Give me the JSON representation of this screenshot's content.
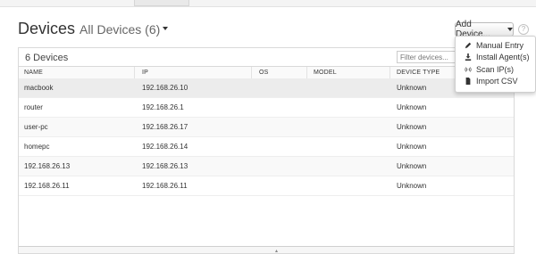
{
  "header": {
    "title": "Devices",
    "subtitle": "All Devices (6)"
  },
  "toolbar": {
    "add_label": "Add Device...",
    "help_glyph": "?"
  },
  "add_menu": {
    "items": [
      {
        "label": "Manual Entry",
        "icon": "pencil-icon"
      },
      {
        "label": "Install Agent(s)",
        "icon": "download-icon"
      },
      {
        "label": "Scan IP(s)",
        "icon": "scan-icon"
      },
      {
        "label": "Import CSV",
        "icon": "file-icon"
      }
    ]
  },
  "list": {
    "count": "6 Devices",
    "filter_placeholder": "Filter devices...",
    "columns": [
      "NAME",
      "IP",
      "OS",
      "MODEL",
      "DEVICE TYPE"
    ],
    "rows": [
      {
        "name": "macbook",
        "ip": "192.168.26.10",
        "os": "",
        "model": "",
        "type": "Unknown"
      },
      {
        "name": "router",
        "ip": "192.168.26.1",
        "os": "",
        "model": "",
        "type": "Unknown"
      },
      {
        "name": "user-pc",
        "ip": "192.168.26.17",
        "os": "",
        "model": "",
        "type": "Unknown"
      },
      {
        "name": "homepc",
        "ip": "192.168.26.14",
        "os": "",
        "model": "",
        "type": "Unknown"
      },
      {
        "name": "192.168.26.13",
        "ip": "192.168.26.13",
        "os": "",
        "model": "",
        "type": "Unknown"
      },
      {
        "name": "192.168.26.11",
        "ip": "192.168.26.11",
        "os": "",
        "model": "",
        "type": "Unknown"
      }
    ]
  }
}
